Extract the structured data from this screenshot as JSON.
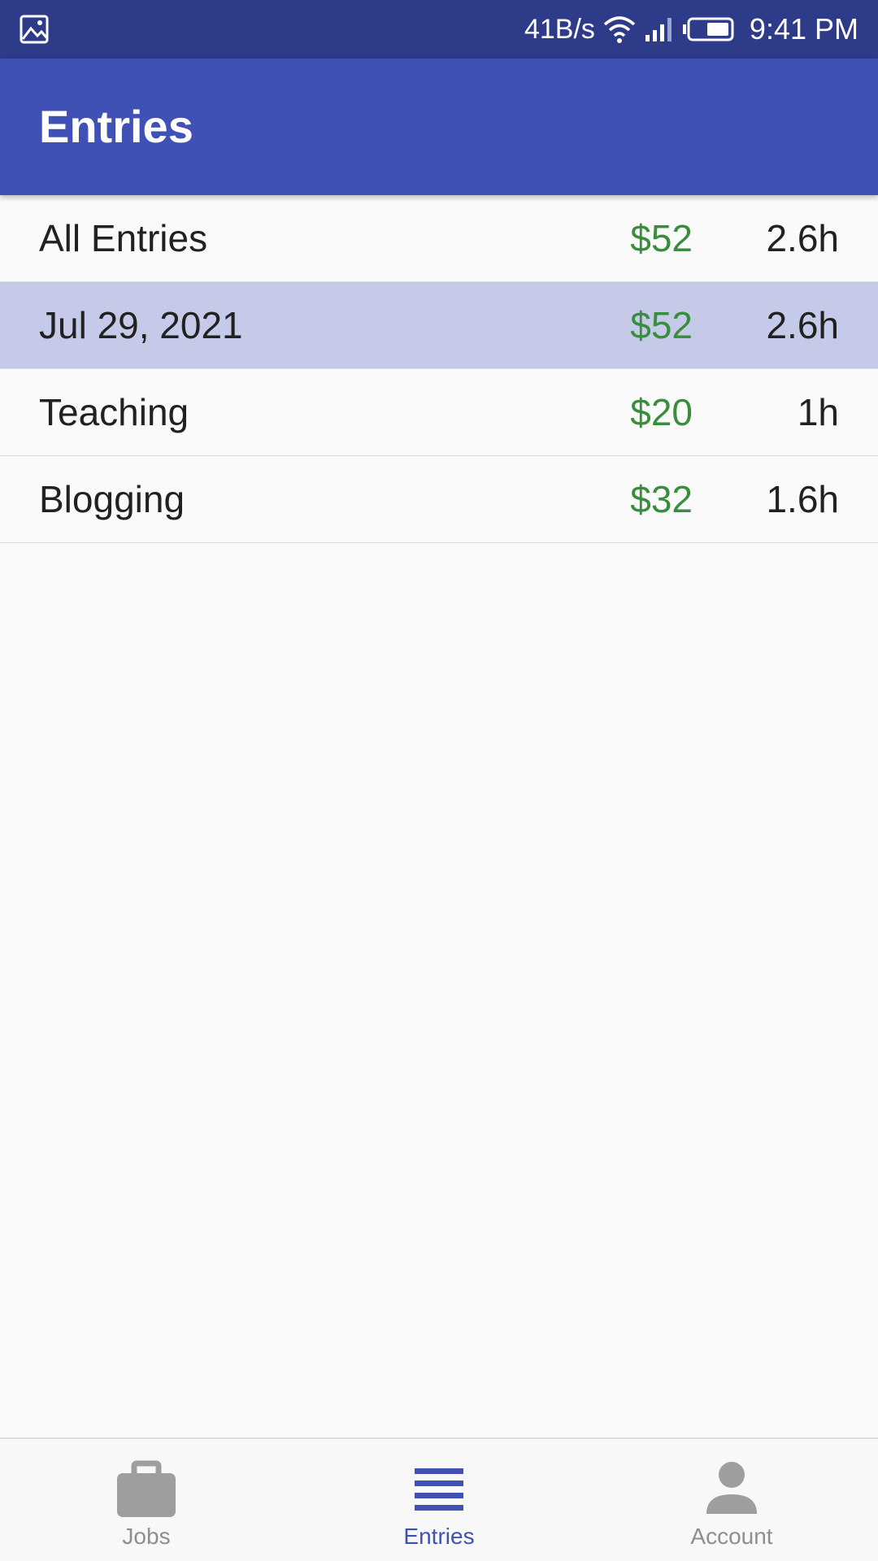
{
  "status_bar": {
    "network_speed": "41B/s",
    "time": "9:41 PM",
    "left_icon": "image-icon",
    "right_icons": [
      "wifi-icon",
      "signal-icon",
      "battery-icon"
    ]
  },
  "app_bar": {
    "title": "Entries",
    "color": "#3f51b5"
  },
  "entries": [
    {
      "label": "All Entries",
      "pay": "$52",
      "hours": "2.6h",
      "selected": false
    },
    {
      "label": "Jul 29, 2021",
      "pay": "$52",
      "hours": "2.6h",
      "selected": true
    },
    {
      "label": "Teaching",
      "pay": "$20",
      "hours": "1h",
      "selected": false
    },
    {
      "label": "Blogging",
      "pay": "$32",
      "hours": "1.6h",
      "selected": false
    }
  ],
  "colors": {
    "pay": "#388e3c",
    "selected_row": "#c5cae9",
    "active_nav": "#3f51b5",
    "inactive_nav": "#8e8e8e"
  },
  "bottom_nav": {
    "items": [
      {
        "label": "Jobs",
        "icon": "briefcase-icon",
        "active": false
      },
      {
        "label": "Entries",
        "icon": "list-icon",
        "active": true
      },
      {
        "label": "Account",
        "icon": "person-icon",
        "active": false
      }
    ]
  }
}
